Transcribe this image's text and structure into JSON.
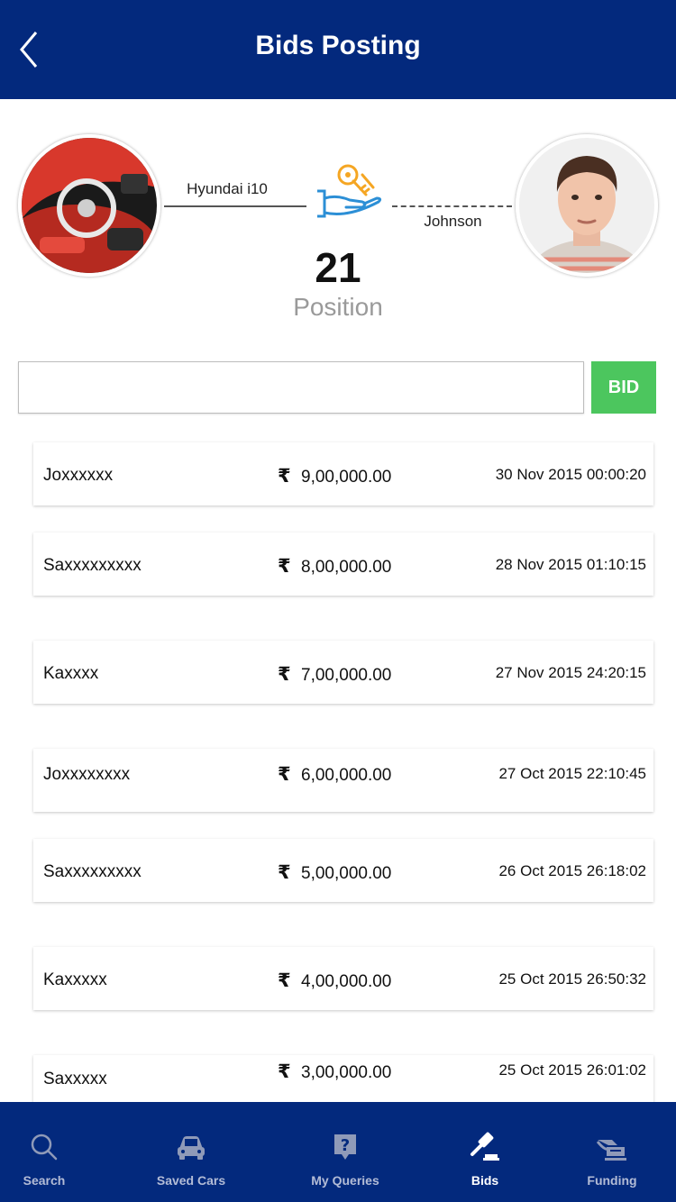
{
  "header": {
    "title": "Bids Posting"
  },
  "deal": {
    "car_name": "Hyundai i10",
    "user_name": "Johnson",
    "position_number": "21",
    "position_label": "Position"
  },
  "bid_form": {
    "input_value": "",
    "button_label": "BID"
  },
  "currency_symbol": "₹",
  "bids": [
    {
      "bidder": "Joxxxxxx",
      "amount": "9,00,000.00",
      "datetime": "30 Nov 2015 00:00:20"
    },
    {
      "bidder": "Saxxxxxxxxx",
      "amount": "8,00,000.00",
      "datetime": "28 Nov 2015 01:10:15"
    },
    {
      "bidder": "Kaxxxx",
      "amount": "7,00,000.00",
      "datetime": "27 Nov 2015 24:20:15"
    },
    {
      "bidder": "Joxxxxxxxx",
      "amount": "6,00,000.00",
      "datetime": "27 Oct 2015 22:10:45"
    },
    {
      "bidder": "Saxxxxxxxxx",
      "amount": "5,00,000.00",
      "datetime": "26 Oct 2015 26:18:02"
    },
    {
      "bidder": "Kaxxxxx",
      "amount": "4,00,000.00",
      "datetime": "25 Oct 2015 26:50:32"
    },
    {
      "bidder": "Saxxxxx",
      "amount": "3,00,000.00",
      "datetime": "25 Oct 2015 26:01:02"
    }
  ],
  "nav": [
    {
      "label": "Search",
      "icon": "search-icon",
      "active": false
    },
    {
      "label": "Saved Cars",
      "icon": "car-icon",
      "active": false
    },
    {
      "label": "My Queries",
      "icon": "question-icon",
      "active": false
    },
    {
      "label": "Bids",
      "icon": "gavel-icon",
      "active": true
    },
    {
      "label": "Funding",
      "icon": "funding-icon",
      "active": false
    }
  ],
  "colors": {
    "header": "#03297d",
    "bid_button": "#4cc65e",
    "position_label": "#9a9a9a",
    "nav_inactive": "#b3bcd6"
  }
}
